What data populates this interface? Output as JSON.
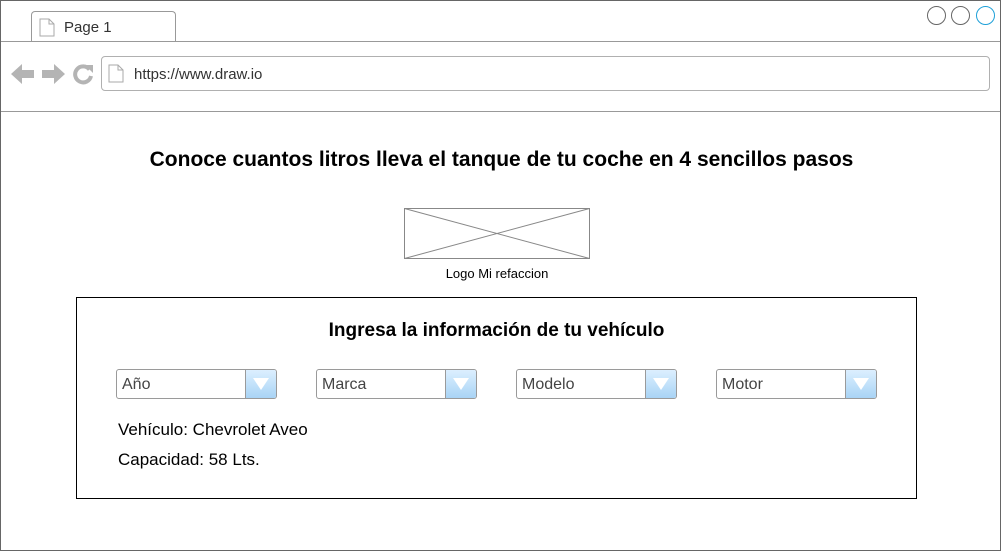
{
  "browser": {
    "tab": {
      "title": "Page 1",
      "icon": "page-icon"
    },
    "url": "https://www.draw.io",
    "nav_icons": [
      "back-arrow-icon",
      "forward-arrow-icon",
      "reload-icon"
    ],
    "window_buttons": [
      "window-button-1",
      "window-button-2",
      "window-button-3"
    ],
    "colors": {
      "active_window_button": "#1ea0d8",
      "chrome_border": "#999999",
      "icon_gray": "#b4b4b4"
    }
  },
  "page": {
    "headline": "Conoce cuantos litros lleva el tanque de tu coche en 4 sencillos pasos",
    "logo": {
      "caption": "Logo Mi refaccion"
    }
  },
  "form": {
    "title": "Ingresa la información de tu vehículo",
    "selects": [
      {
        "label": "Año"
      },
      {
        "label": "Marca"
      },
      {
        "label": "Modelo"
      },
      {
        "label": "Motor"
      }
    ],
    "vehicle_text": "Vehículo: Chevrolet Aveo",
    "capacity_text": "Capacidad: 58 Lts.",
    "colors": {
      "dropdown_button_top": "#dcefff",
      "dropdown_button_bottom": "#a9d4f5"
    }
  }
}
